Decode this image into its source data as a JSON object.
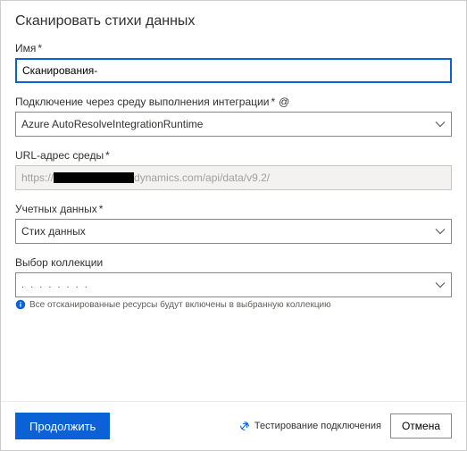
{
  "dialog": {
    "title": "Сканировать стихи данных"
  },
  "fields": {
    "name": {
      "label": "Имя",
      "value": "Сканирования-"
    },
    "runtime": {
      "label": "Подключение через среду выполнения интеграции",
      "value": "Azure AutoResolveIntegrationRuntime"
    },
    "url": {
      "label": "URL-адрес среды",
      "prefix": "https://",
      "suffix": "dynamics.com/api/data/v9.2/"
    },
    "credentials": {
      "label": "Учетных данных",
      "value": "Стих данных"
    },
    "collection": {
      "label": "Выбор коллекции",
      "value": ". . . . . . . .",
      "info": "Все отсканированные ресурсы будут включены в выбранную коллекцию"
    }
  },
  "footer": {
    "continue": "Продолжить",
    "test": "Тестирование подключения",
    "cancel": "Отмена"
  }
}
